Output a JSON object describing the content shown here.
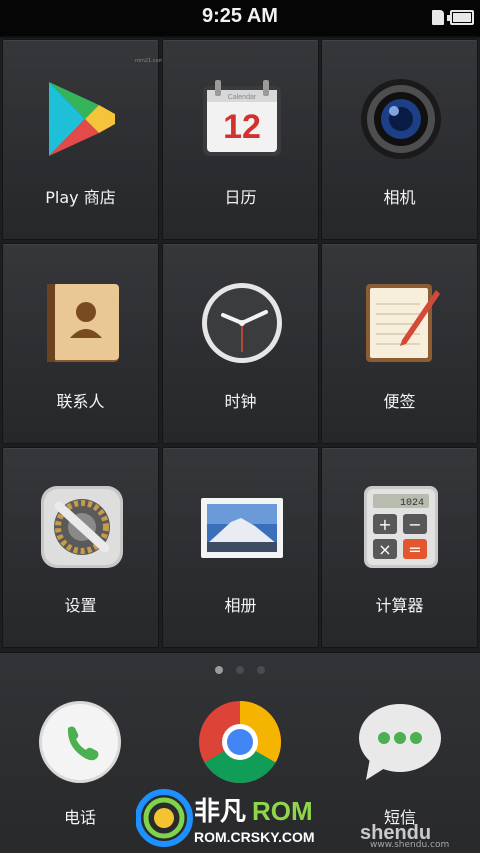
{
  "status_bar": {
    "time": "9:25 AM"
  },
  "tiny_text": "rom21.com",
  "apps": [
    {
      "label": "Play 商店",
      "icon": "google-play-icon"
    },
    {
      "label": "日历",
      "icon": "calendar-icon",
      "calendar_header": "Calendar",
      "calendar_day": "12"
    },
    {
      "label": "相机",
      "icon": "camera-icon"
    },
    {
      "label": "联系人",
      "icon": "contacts-book-icon"
    },
    {
      "label": "时钟",
      "icon": "clock-icon"
    },
    {
      "label": "便签",
      "icon": "notepad-icon"
    },
    {
      "label": "设置",
      "icon": "settings-gear-icon"
    },
    {
      "label": "相册",
      "icon": "gallery-icon"
    },
    {
      "label": "计算器",
      "icon": "calculator-icon",
      "display": "1024"
    }
  ],
  "page_indicator": {
    "count": 3,
    "active": 1
  },
  "dock": [
    {
      "label": "电话",
      "icon": "phone-icon"
    },
    {
      "label": "",
      "icon": "chrome-icon"
    },
    {
      "label": "短信",
      "icon": "messages-icon"
    }
  ],
  "watermark": {
    "brand_cn": "非凡",
    "brand_en": "ROM",
    "site": "ROM.CRSKY.COM",
    "shendu": "shendu",
    "shendu_site": "www.shendu.com"
  },
  "colors": {
    "background": "#1d1e20",
    "tile": "#2f3033",
    "text": "#f4f4f4"
  }
}
